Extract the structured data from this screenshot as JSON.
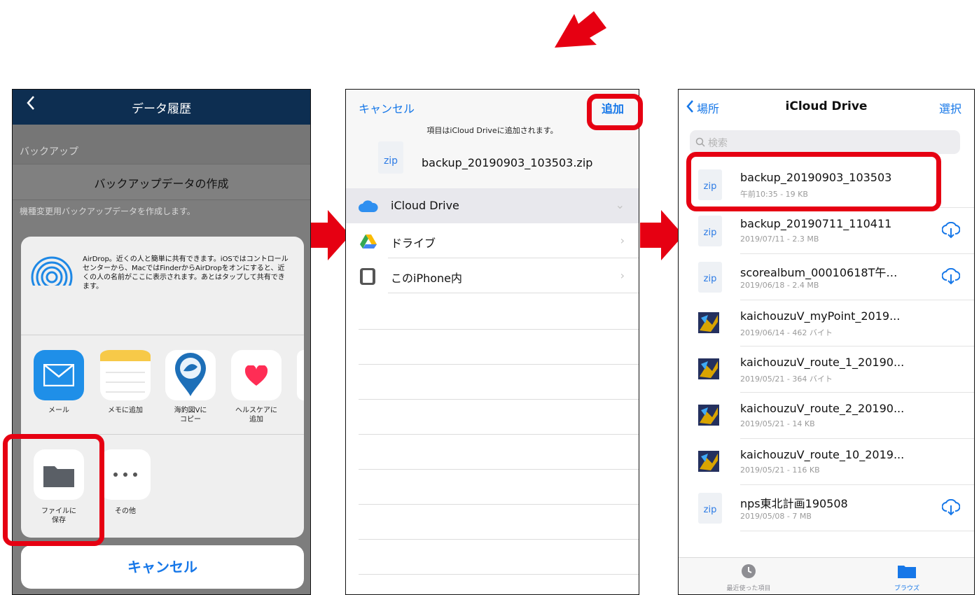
{
  "colors": {
    "accent": "#e60012",
    "ios_blue": "#1677e8",
    "nav_dark": "#0d2e51"
  },
  "phone1": {
    "title": "データ履歴",
    "section": "バックアップ",
    "create_button": "バックアップデータの作成",
    "description": "機種変更用バックアップデータを作成します。",
    "airdrop_text": "AirDrop。近くの人と簡単に共有できます。iOSではコントロールセンターから、MacではFinderからAirDropをオンにすると、近くの人の名前がここに表示されます。あとはタップして共有できます。",
    "apps": [
      {
        "label": "メール",
        "icon": "mail-icon"
      },
      {
        "label": "メモに追加",
        "icon": "notes-icon"
      },
      {
        "label": "海釣図Vに\nコピー",
        "icon": "fishing-chart-icon"
      },
      {
        "label": "ヘルスケアに\n追加",
        "icon": "heart-icon"
      }
    ],
    "actions": [
      {
        "label": "ファイルに\n保存",
        "icon": "folder-icon"
      },
      {
        "label": "その他",
        "icon": "more-icon"
      }
    ],
    "cancel": "キャンセル"
  },
  "phone2": {
    "cancel": "キャンセル",
    "add": "追加",
    "subtitle": "項目はiCloud Driveに追加されます。",
    "file_ext": "zip",
    "file_name": "backup_20190903_103503.zip",
    "locations": [
      {
        "label": "iCloud Drive",
        "icon": "icloud-icon"
      },
      {
        "label": "ドライブ",
        "icon": "google-drive-icon"
      },
      {
        "label": "このiPhone内",
        "icon": "iphone-icon"
      }
    ]
  },
  "phone3": {
    "back": "場所",
    "title": "iCloud Drive",
    "select": "選択",
    "search_placeholder": "検索",
    "files": [
      {
        "name": "backup_20190903_103503",
        "meta": "午前10:35 - 19 KB",
        "type": "zip",
        "cloud": false
      },
      {
        "name": "backup_20190711_110411",
        "meta": "2019/07/11 - 2.3 MB",
        "type": "zip",
        "cloud": true
      },
      {
        "name": "scorealbum_00010618T午…",
        "meta": "2019/06/18 - 2.4 MB",
        "type": "zip",
        "cloud": true
      },
      {
        "name": "kaichouzuV_myPoint_2019...",
        "meta": "2019/06/14 - 462 バイト",
        "type": "app",
        "cloud": false
      },
      {
        "name": "kaichouzuV_route_1_20190...",
        "meta": "2019/05/21 - 364 バイト",
        "type": "app",
        "cloud": false
      },
      {
        "name": "kaichouzuV_route_2_20190...",
        "meta": "2019/05/21 - 14 KB",
        "type": "app",
        "cloud": false
      },
      {
        "name": "kaichouzuV_route_10_2019...",
        "meta": "2019/05/21 - 116 KB",
        "type": "app",
        "cloud": false
      },
      {
        "name": "nps東北計画190508",
        "meta": "2019/05/08 - 7 MB",
        "type": "zip",
        "cloud": true
      }
    ],
    "tabs": [
      {
        "label": "最近使った項目",
        "icon": "clock-icon"
      },
      {
        "label": "ブラウズ",
        "icon": "folder-icon"
      }
    ]
  }
}
